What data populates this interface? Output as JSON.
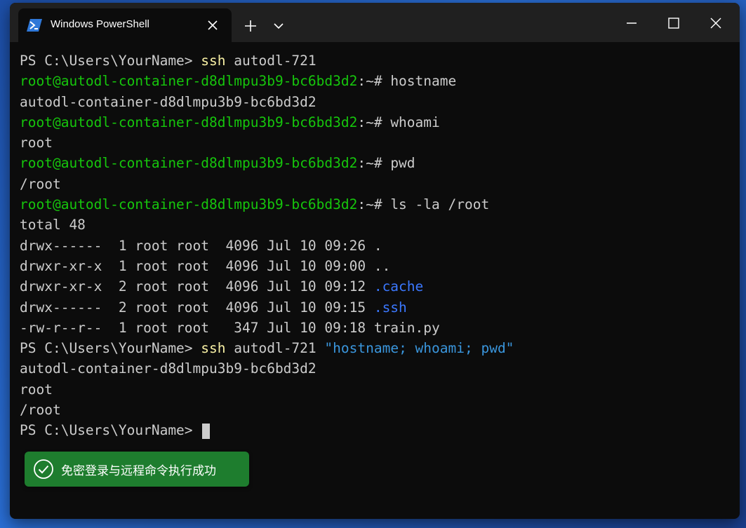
{
  "window": {
    "tab_title": "Windows PowerShell"
  },
  "terminal": {
    "line1": {
      "prompt": "PS C:\\Users\\YourName> ",
      "cmd": "ssh",
      "rest": " autodl-721"
    },
    "line2": {
      "user": "root@autodl-container-d8dlmpu3b9-bc6bd3d2",
      "sym": ":~# ",
      "cmd": "hostname"
    },
    "line3": "autodl-container-d8dlmpu3b9-bc6bd3d2",
    "line4": {
      "user": "root@autodl-container-d8dlmpu3b9-bc6bd3d2",
      "sym": ":~# ",
      "cmd": "whoami"
    },
    "line5": "root",
    "line6": {
      "user": "root@autodl-container-d8dlmpu3b9-bc6bd3d2",
      "sym": ":~# ",
      "cmd": "pwd"
    },
    "line7": "/root",
    "line8": {
      "user": "root@autodl-container-d8dlmpu3b9-bc6bd3d2",
      "sym": ":~# ",
      "cmd": "ls -la /root"
    },
    "line9": "total 48",
    "ls_rows": [
      {
        "text": "drwx------  1 root root  4096 Jul 10 09:26 ",
        "name": "."
      },
      {
        "text": "drwxr-xr-x  1 root root  4096 Jul 10 09:00 ",
        "name": ".."
      },
      {
        "text": "drwxr-xr-x  2 root root  4096 Jul 10 09:12 ",
        "name": ".cache"
      },
      {
        "text": "drwx------  2 root root  4096 Jul 10 09:15 ",
        "name": ".ssh"
      },
      {
        "text": "-rw-r--r--  1 root root   347 Jul 10 09:18 ",
        "name": "train.py"
      }
    ],
    "line15": {
      "prompt": "PS C:\\Users\\YourName> ",
      "cmd": "ssh",
      "rest": " autodl-721 ",
      "str": "\"hostname; whoami; pwd\""
    },
    "line16": "autodl-container-d8dlmpu3b9-bc6bd3d2",
    "line17": "root",
    "line18": "/root",
    "line19": {
      "prompt": "PS C:\\Users\\YourName> "
    }
  },
  "toast": {
    "message": "免密登录与远程命令执行成功",
    "icon": "check-circle-icon"
  },
  "colors": {
    "background": "#0c0c0c",
    "titlebar": "#202020",
    "prompt_green": "#16c60c",
    "ssh_yellow": "#f9f1a5",
    "dir_blue": "#3b78ff",
    "string_blue": "#3a96dd",
    "toast_green": "#1e7d2e"
  }
}
